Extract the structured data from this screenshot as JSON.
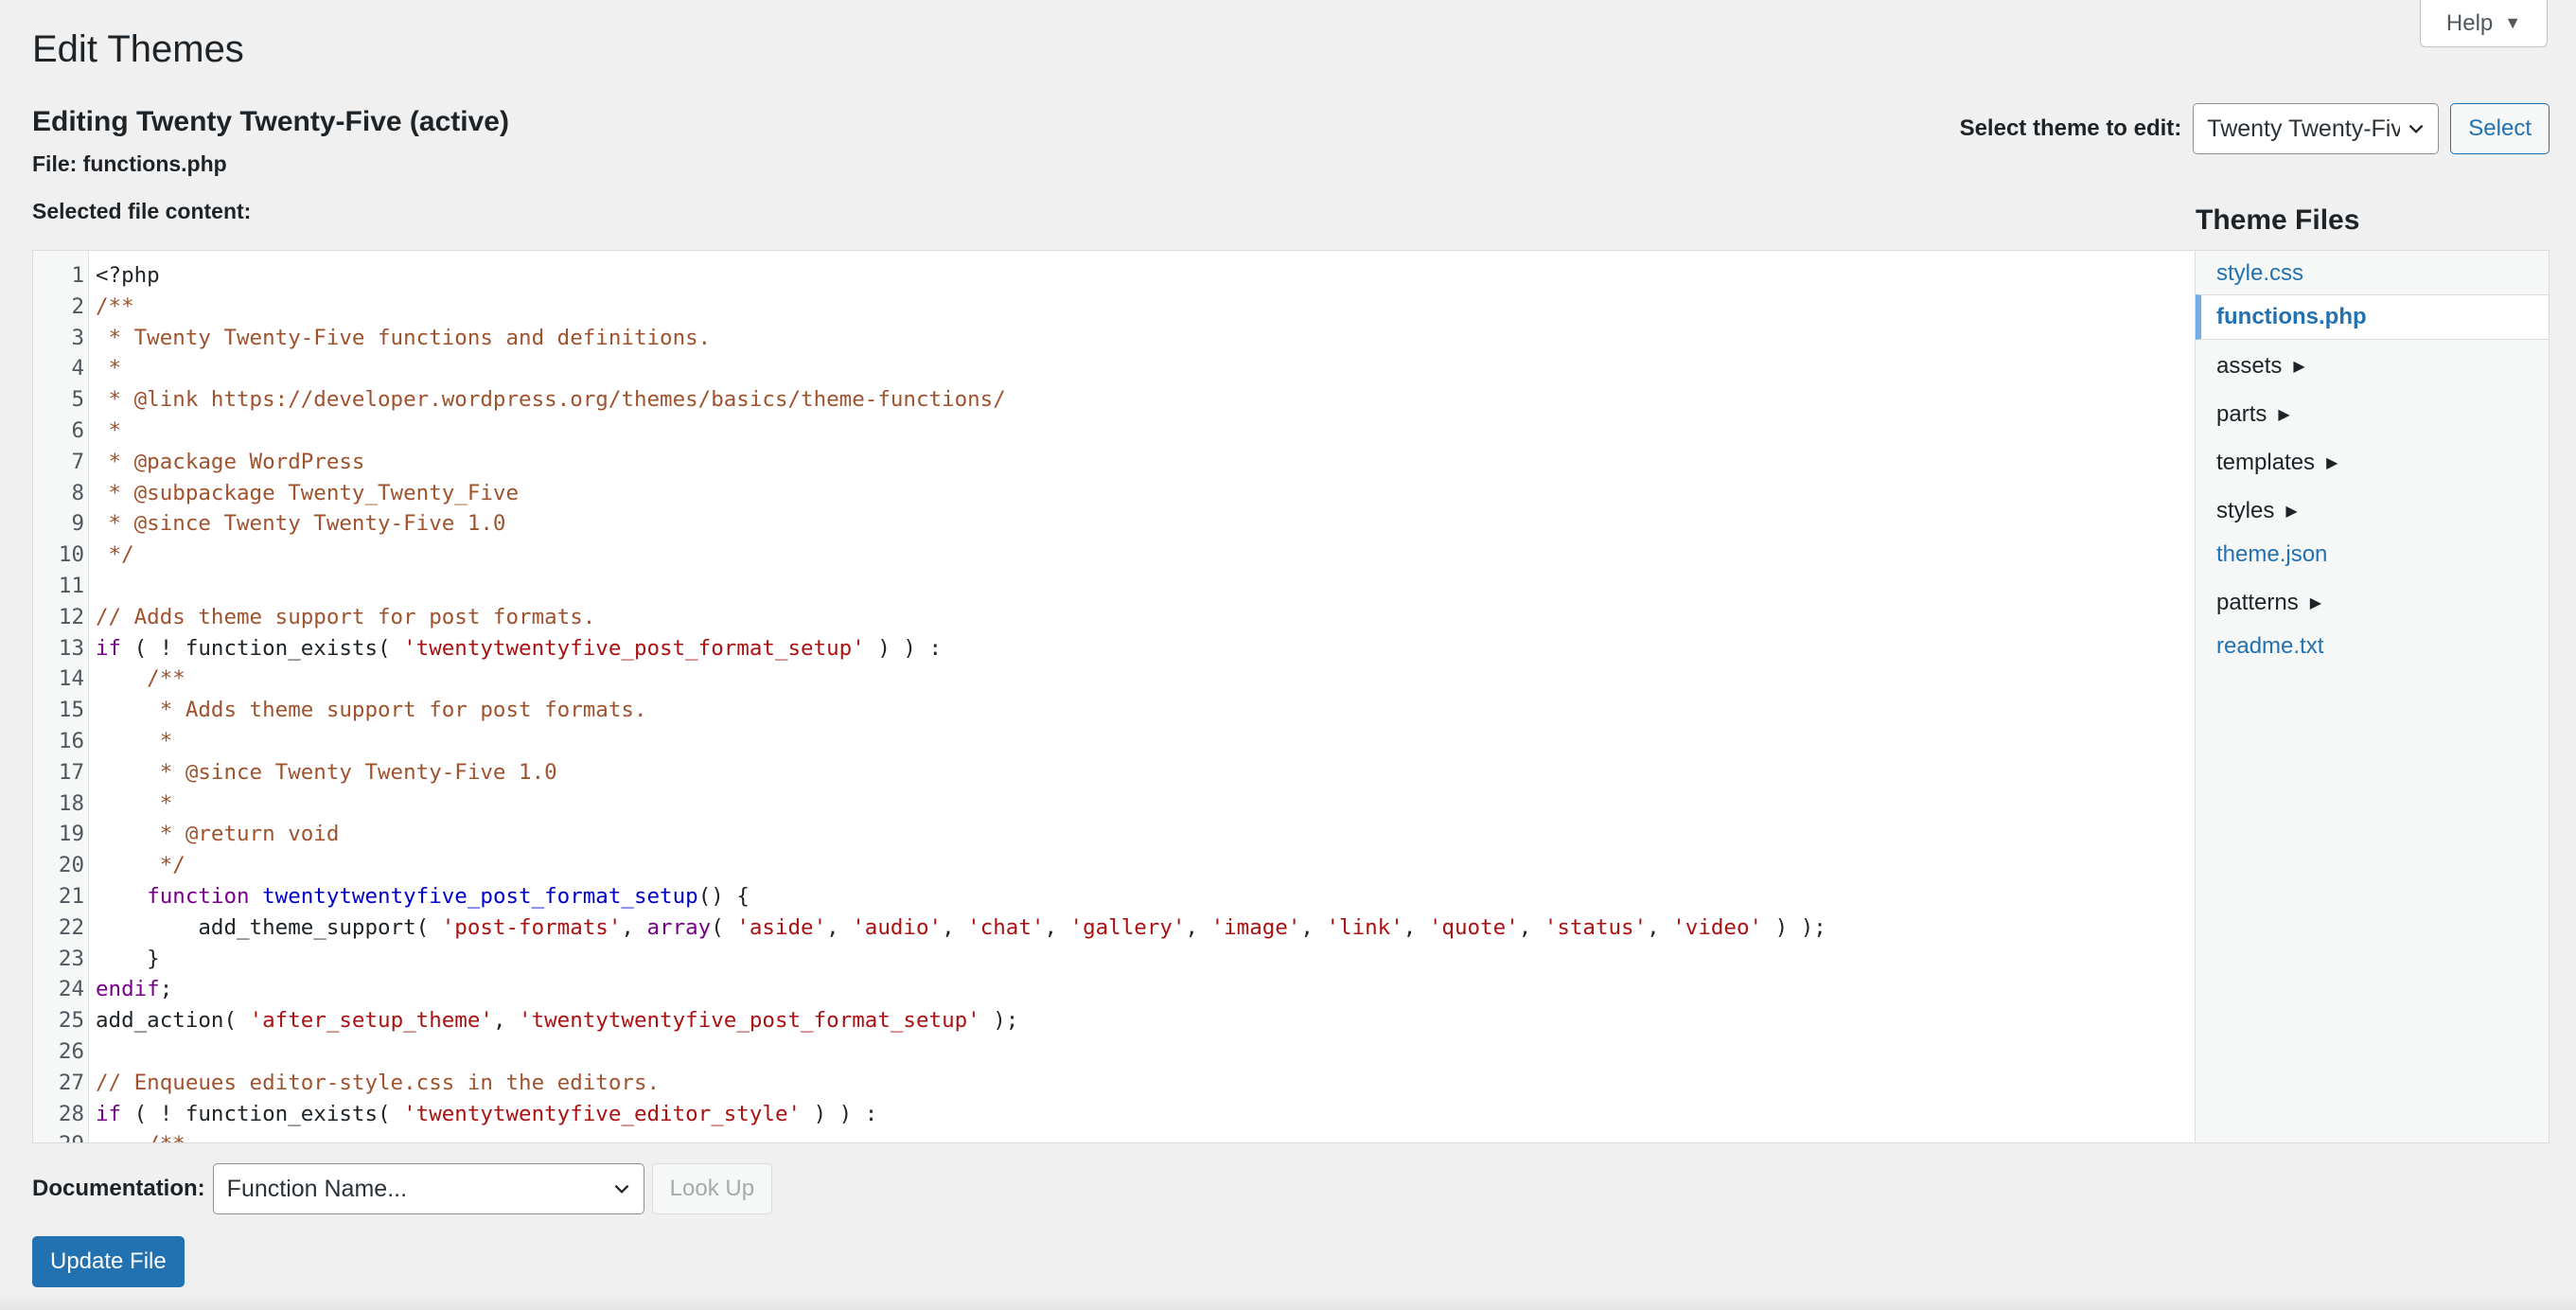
{
  "help": {
    "label": "Help",
    "caret": "▼"
  },
  "page_title": "Edit Themes",
  "editing_title": "Editing Twenty Twenty-Five (active)",
  "file_label": "File:",
  "file_name": "functions.php",
  "selected_content_label": "Selected file content:",
  "theme_select": {
    "label": "Select theme to edit:",
    "value": "Twenty Twenty-Five",
    "button": "Select"
  },
  "theme_files": {
    "title": "Theme Files",
    "items": [
      {
        "label": "style.css",
        "type": "file",
        "active": false
      },
      {
        "label": "functions.php",
        "type": "file",
        "active": true
      },
      {
        "label": "assets",
        "type": "folder",
        "active": false
      },
      {
        "label": "parts",
        "type": "folder",
        "active": false
      },
      {
        "label": "templates",
        "type": "folder",
        "active": false
      },
      {
        "label": "styles",
        "type": "folder",
        "active": false
      },
      {
        "label": "theme.json",
        "type": "file",
        "active": false
      },
      {
        "label": "patterns",
        "type": "folder",
        "active": false
      },
      {
        "label": "readme.txt",
        "type": "file",
        "active": false
      }
    ]
  },
  "code_lines": [
    [
      [
        "p",
        "<?php"
      ]
    ],
    [
      [
        "c",
        "/**"
      ]
    ],
    [
      [
        "c",
        " * Twenty Twenty-Five functions and definitions."
      ]
    ],
    [
      [
        "c",
        " *"
      ]
    ],
    [
      [
        "c",
        " * @link https://developer.wordpress.org/themes/basics/theme-functions/"
      ]
    ],
    [
      [
        "c",
        " *"
      ]
    ],
    [
      [
        "c",
        " * @package WordPress"
      ]
    ],
    [
      [
        "c",
        " * @subpackage Twenty_Twenty_Five"
      ]
    ],
    [
      [
        "c",
        " * @since Twenty Twenty-Five 1.0"
      ]
    ],
    [
      [
        "c",
        " */"
      ]
    ],
    [
      [
        "p",
        ""
      ]
    ],
    [
      [
        "c",
        "// Adds theme support for post formats."
      ]
    ],
    [
      [
        "k",
        "if"
      ],
      [
        "p",
        " ( ! function_exists( "
      ],
      [
        "s",
        "'twentytwentyfive_post_format_setup'"
      ],
      [
        "p",
        " ) ) :"
      ]
    ],
    [
      [
        "c",
        "    /**"
      ]
    ],
    [
      [
        "c",
        "     * Adds theme support for post formats."
      ]
    ],
    [
      [
        "c",
        "     *"
      ]
    ],
    [
      [
        "c",
        "     * @since Twenty Twenty-Five 1.0"
      ]
    ],
    [
      [
        "c",
        "     *"
      ]
    ],
    [
      [
        "c",
        "     * @return void"
      ]
    ],
    [
      [
        "c",
        "     */"
      ]
    ],
    [
      [
        "p",
        "    "
      ],
      [
        "k",
        "function"
      ],
      [
        "p",
        " "
      ],
      [
        "f",
        "twentytwentyfive_post_format_setup"
      ],
      [
        "p",
        "() {"
      ]
    ],
    [
      [
        "p",
        "        add_theme_support( "
      ],
      [
        "s",
        "'post-formats'"
      ],
      [
        "p",
        ", "
      ],
      [
        "k",
        "array"
      ],
      [
        "p",
        "( "
      ],
      [
        "s",
        "'aside'"
      ],
      [
        "p",
        ", "
      ],
      [
        "s",
        "'audio'"
      ],
      [
        "p",
        ", "
      ],
      [
        "s",
        "'chat'"
      ],
      [
        "p",
        ", "
      ],
      [
        "s",
        "'gallery'"
      ],
      [
        "p",
        ", "
      ],
      [
        "s",
        "'image'"
      ],
      [
        "p",
        ", "
      ],
      [
        "s",
        "'link'"
      ],
      [
        "p",
        ", "
      ],
      [
        "s",
        "'quote'"
      ],
      [
        "p",
        ", "
      ],
      [
        "s",
        "'status'"
      ],
      [
        "p",
        ", "
      ],
      [
        "s",
        "'video'"
      ],
      [
        "p",
        " ) );"
      ]
    ],
    [
      [
        "p",
        "    }"
      ]
    ],
    [
      [
        "k",
        "endif"
      ],
      [
        "p",
        ";"
      ]
    ],
    [
      [
        "p",
        "add_action( "
      ],
      [
        "s",
        "'after_setup_theme'"
      ],
      [
        "p",
        ", "
      ],
      [
        "s",
        "'twentytwentyfive_post_format_setup'"
      ],
      [
        "p",
        " );"
      ]
    ],
    [
      [
        "p",
        ""
      ]
    ],
    [
      [
        "c",
        "// Enqueues editor-style.css in the editors."
      ]
    ],
    [
      [
        "k",
        "if"
      ],
      [
        "p",
        " ( ! function_exists( "
      ],
      [
        "s",
        "'twentytwentyfive_editor_style'"
      ],
      [
        "p",
        " ) ) :"
      ]
    ],
    [
      [
        "c",
        "    /**"
      ]
    ]
  ],
  "documentation": {
    "label": "Documentation:",
    "select_value": "Function Name...",
    "lookup_button": "Look Up"
  },
  "update_button": "Update File"
}
